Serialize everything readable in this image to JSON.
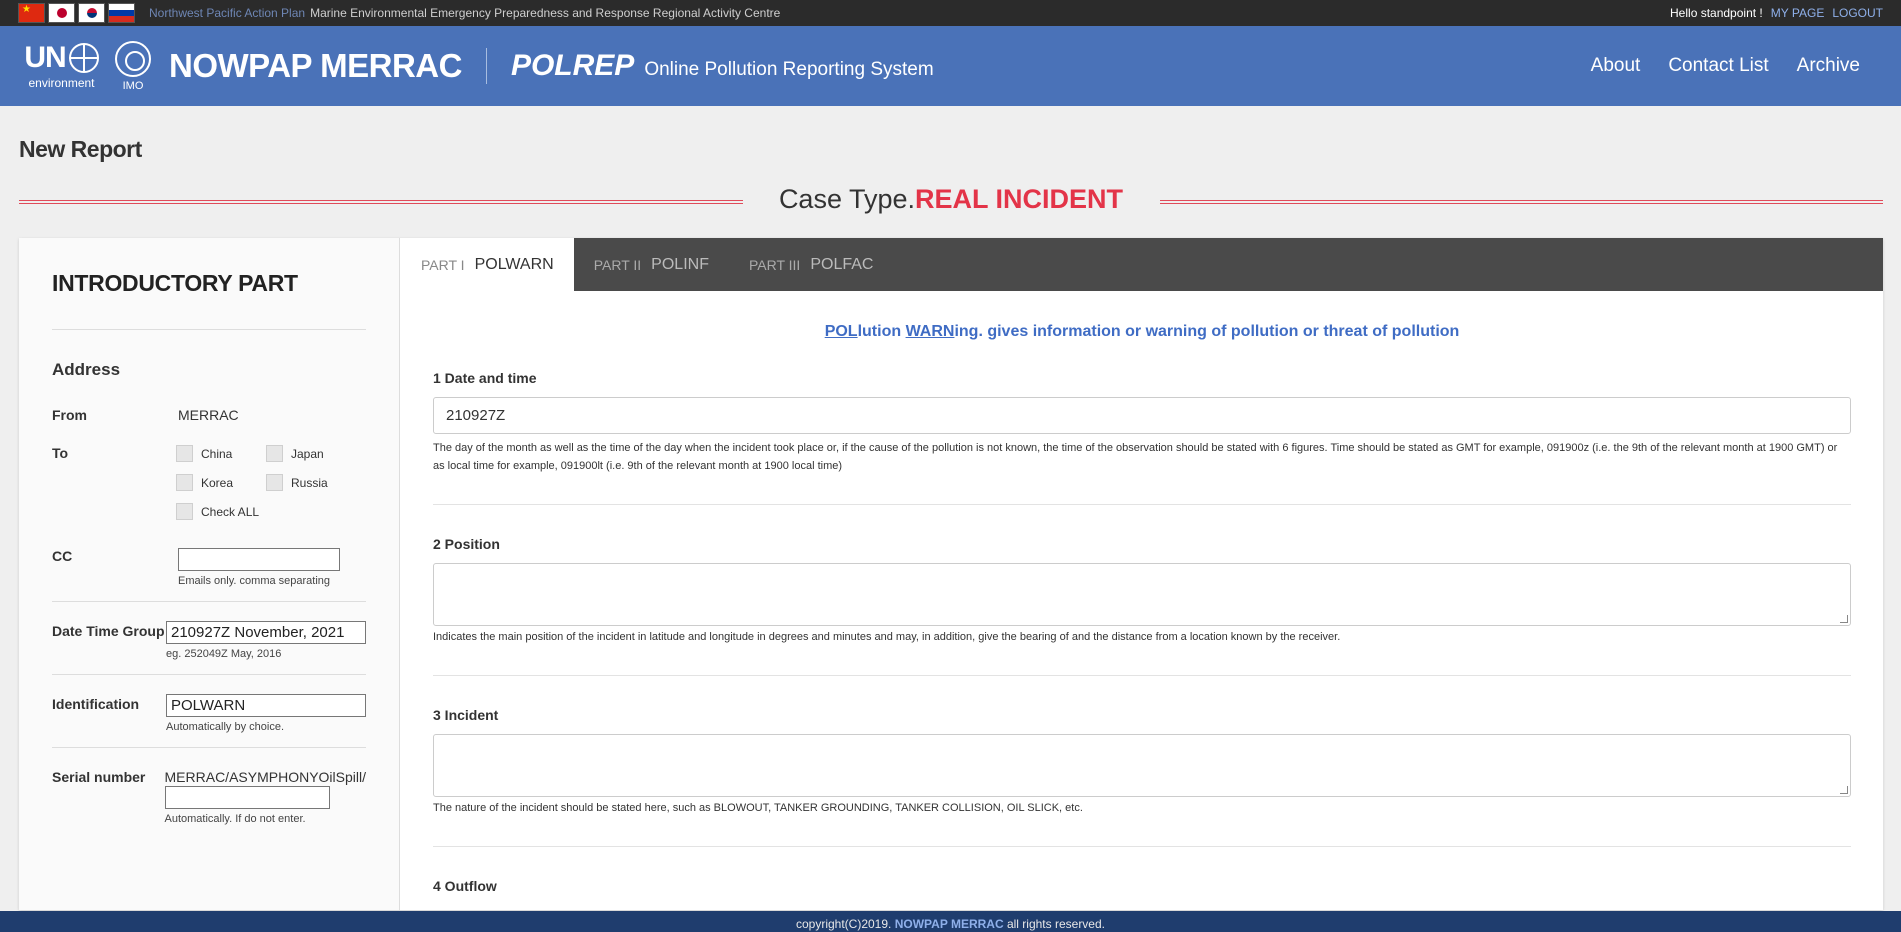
{
  "topbar": {
    "subtitle_1": "Northwest Pacific Action Plan",
    "subtitle_2": "Marine Environmental Emergency Preparedness and Response Regional Activity Centre",
    "hello": "Hello standpoint !",
    "my_page": "MY PAGE",
    "logout": "LOGOUT",
    "flags": [
      "china-flag-icon",
      "japan-flag-icon",
      "korea-flag-icon",
      "russia-flag-icon"
    ]
  },
  "header": {
    "un_letters": "UN",
    "un_sub": "environment",
    "imo_sub": "IMO",
    "brand": "NOWPAP MERRAC",
    "polrep": "POLREP",
    "system_name": "Online Pollution Reporting System",
    "nav": [
      "About",
      "Contact List",
      "Archive"
    ],
    "colors": {
      "header_bg": "#4a72b8",
      "topbar_bg": "#2b2b2b"
    }
  },
  "page": {
    "title": "New Report",
    "case_type_label": "Case Type.",
    "case_type_value": "REAL INCIDENT",
    "case_color": "#e33448"
  },
  "sidebar": {
    "title": "INTRODUCTORY PART",
    "address_title": "Address",
    "from_label": "From",
    "from_value": "MERRAC",
    "to_label": "To",
    "to_options": [
      "China",
      "Japan",
      "Korea",
      "Russia",
      "Check ALL"
    ],
    "cc_label": "CC",
    "cc_value": "",
    "cc_help": "Emails only. comma separating",
    "dtg_label": "Date Time Group",
    "dtg_value": "210927Z November, 2021",
    "dtg_help": "eg. 252049Z May, 2016",
    "id_label": "Identification",
    "id_value": "POLWARN",
    "id_help": "Automatically by choice.",
    "serial_label": "Serial number",
    "serial_prefix": "MERRAC/ASYMPHONYOilSpill/",
    "serial_value": "",
    "serial_help": "Automatically. If do not enter."
  },
  "tabs": [
    {
      "num": "PART I",
      "name": "POLWARN",
      "active": true
    },
    {
      "num": "PART II",
      "name": "POLINF",
      "active": false
    },
    {
      "num": "PART III",
      "name": "POLFAC",
      "active": false
    }
  ],
  "content": {
    "desc_pol": "POL",
    "desc_lution": "lution ",
    "desc_warn": "WARN",
    "desc_rest": "ing. gives information or warning of pollution or threat of pollution",
    "fields": [
      {
        "title": "1 Date and time",
        "value": "210927Z",
        "help": "The day of the month as well as the time of the day when the incident took place or, if the cause of the pollution is not known, the time of the observation should be stated with 6 figures. Time should be stated as GMT for example, 091900z (i.e. the 9th of the relevant month at 1900 GMT) or as local time for example, 091900lt (i.e. 9th of the relevant month at 1900 local time)"
      },
      {
        "title": "2 Position",
        "value": "",
        "help": "Indicates the main position of the incident in latitude and longitude in degrees and minutes and may, in addition, give the bearing of and the distance from a location known by the receiver."
      },
      {
        "title": "3 Incident",
        "value": "",
        "help": "The nature of the incident should be stated here, such as BLOWOUT, TANKER GROUNDING, TANKER COLLISION, OIL SLICK, etc."
      },
      {
        "title": "4 Outflow"
      }
    ]
  },
  "footer": {
    "prefix": "copyright(C)2019.",
    "brand": "NOWPAP MERRAC",
    "suffix": "all rights reserved."
  }
}
